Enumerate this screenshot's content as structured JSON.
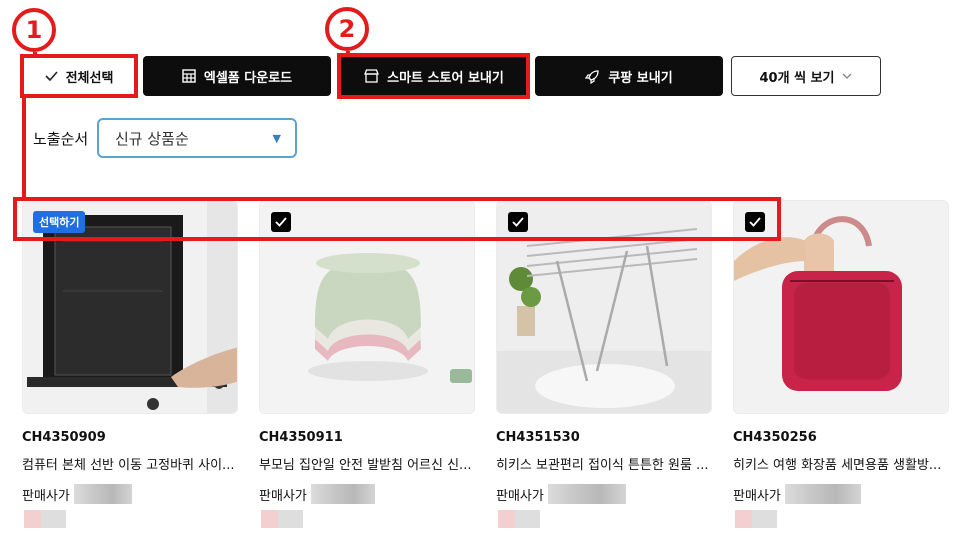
{
  "annotations": {
    "step1": "1",
    "step2": "2"
  },
  "toolbar": {
    "select_all": "전체선택",
    "excel_download": "엑셀폼 다운로드",
    "smartstore_send": "스마트 스토어 보내기",
    "coupang_send": "쿠팡 보내기",
    "view_count": "40개 씩 보기"
  },
  "sort": {
    "label": "노출순서",
    "selected": "신규 상품순"
  },
  "products": [
    {
      "code": "CH4350909",
      "title": "컴퓨터 본체 선반 이동 고정바퀴 사이...",
      "seller_label": "판매사가",
      "chip": "선택하기"
    },
    {
      "code": "CH4350911",
      "title": "부모님 집안일 안전 발받침 어르신 신...",
      "seller_label": "판매사가"
    },
    {
      "code": "CH4351530",
      "title": "히키스 보관편리 접이식 튼튼한 원룸 ...",
      "seller_label": "판매사가"
    },
    {
      "code": "CH4350256",
      "title": "히키스 여행 화장품 세면용품 생활방...",
      "seller_label": "판매사가"
    }
  ],
  "colors": {
    "highlight": "#e41b1b",
    "chip": "#1f6fe0",
    "select_border": "#5aa4d4"
  }
}
